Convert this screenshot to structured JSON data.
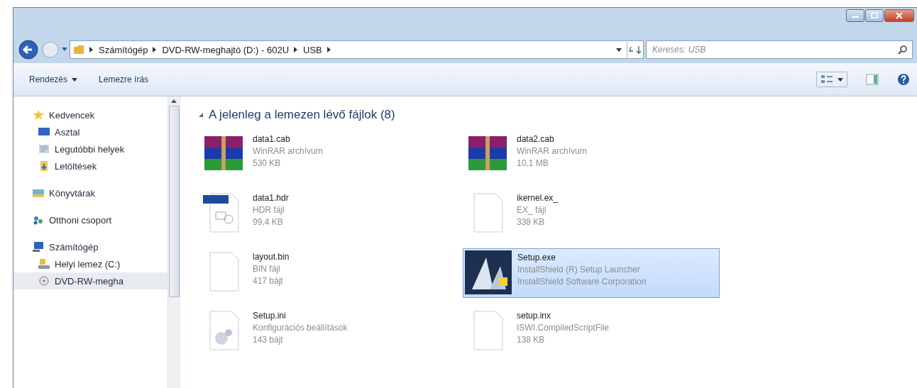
{
  "address": {
    "crumbs": [
      "Számítógép",
      "DVD-RW-meghajtó (D:) - 602U",
      "USB"
    ]
  },
  "search": {
    "placeholder": "Keresés: USB"
  },
  "toolbar": {
    "items": [
      {
        "label": "Rendezés",
        "dropdown": true
      },
      {
        "label": "Lemezre írás",
        "dropdown": false
      }
    ]
  },
  "sidebar": {
    "groups": [
      {
        "label": "Kedvencek",
        "kind": "star",
        "children": [
          {
            "label": "Asztal",
            "kind": "desktop",
            "selected": false
          },
          {
            "label": "Legutóbbi helyek",
            "kind": "recent",
            "selected": false
          },
          {
            "label": "Letöltések",
            "kind": "download",
            "selected": false
          }
        ]
      },
      {
        "label": "Könyvtárak",
        "kind": "library"
      },
      {
        "label": "Otthoni csoport",
        "kind": "homegroup"
      },
      {
        "label": "Számítógép",
        "kind": "computer",
        "children": [
          {
            "label": "Helyi lemez (C:)",
            "kind": "disk",
            "selected": false
          },
          {
            "label": "DVD-RW-megha",
            "kind": "dvd",
            "selected": true
          }
        ]
      }
    ]
  },
  "content": {
    "group_header": "A jelenleg a lemezen lévő fájlok (8)",
    "files": [
      {
        "name": "data1.cab",
        "kind": "archive",
        "lines": [
          "WinRAR archívum",
          "530 KB"
        ],
        "selected": false
      },
      {
        "name": "data2.cab",
        "kind": "archive",
        "lines": [
          "WinRAR archívum",
          "10,1 MB"
        ],
        "selected": false
      },
      {
        "name": "data1.hdr",
        "kind": "hdr",
        "lines": [
          "HDR fájl",
          "99,4 KB"
        ],
        "selected": false
      },
      {
        "name": "ikernel.ex_",
        "kind": "blank",
        "lines": [
          "EX_ fájl",
          "338 KB"
        ],
        "selected": false
      },
      {
        "name": "layout.bin",
        "kind": "blank",
        "lines": [
          "BIN fájl",
          "417 bájt"
        ],
        "selected": false
      },
      {
        "name": "Setup.exe",
        "kind": "installer",
        "lines": [
          "InstallShield (R) Setup Launcher",
          "InstallShield Software Corporation"
        ],
        "selected": true
      },
      {
        "name": "Setup.ini",
        "kind": "settings",
        "lines": [
          "Konfigurációs beállítások",
          "143 bájt"
        ],
        "selected": false
      },
      {
        "name": "setup.inx",
        "kind": "blank",
        "lines": [
          "ISWI.CompiledScriptFile",
          "138 KB"
        ],
        "selected": false
      }
    ]
  }
}
